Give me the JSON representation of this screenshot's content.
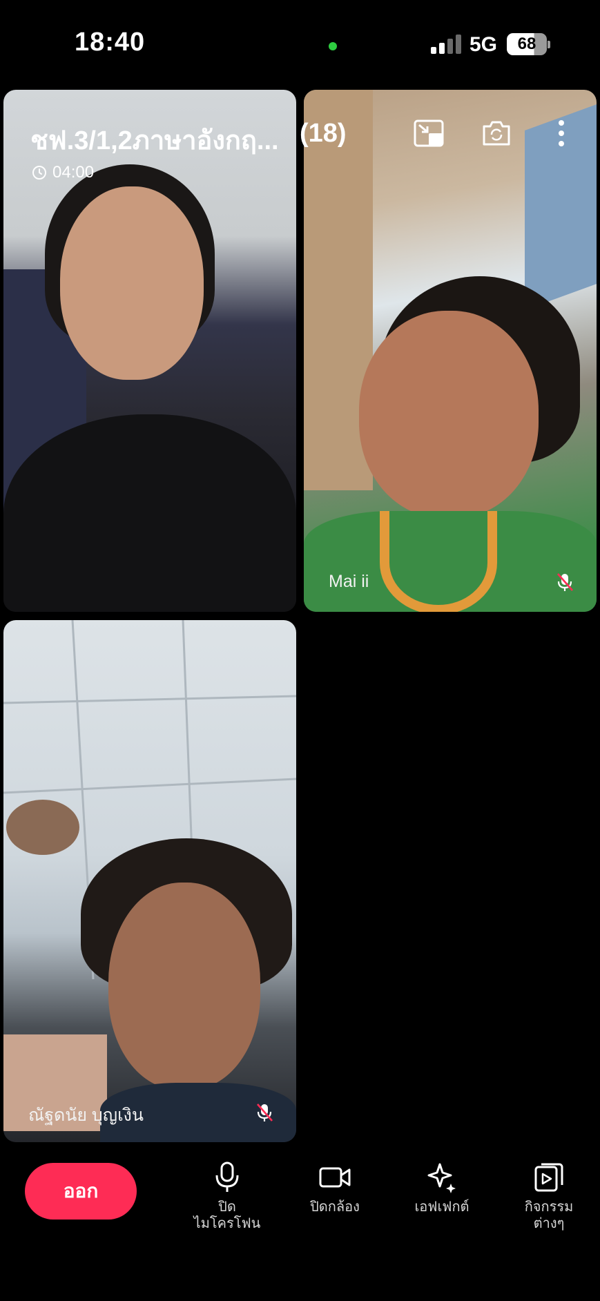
{
  "status_bar": {
    "time": "18:40",
    "network": "5G",
    "battery": "68",
    "dot_color": "#2ecc40"
  },
  "call": {
    "title": "ชฟ.3/1,2ภาษาอังกฤ...",
    "participant_count": "(18)",
    "timer": "04:00"
  },
  "participants": [
    {
      "name": ""
    },
    {
      "name": "Mai ii"
    },
    {
      "name": "ณัฐดนัย บุญเงิน"
    }
  ],
  "toolbar": {
    "leave_label": "ออก",
    "mic_label": "ปิด\nไมโครโฟน",
    "camera_label": "ปิดกล้อง",
    "effects_label": "เอฟเฟกต์",
    "activities_label": "กิจกรรม\nต่างๆ"
  },
  "colors": {
    "accent": "#fe2c55",
    "mute_slash": "#fe2c55"
  },
  "icons": {
    "header": [
      "minimize-icon",
      "switch-camera-icon",
      "more-icon"
    ],
    "toolbar": [
      "microphone-icon",
      "video-camera-icon",
      "sparkle-icon",
      "play-cards-icon"
    ]
  }
}
